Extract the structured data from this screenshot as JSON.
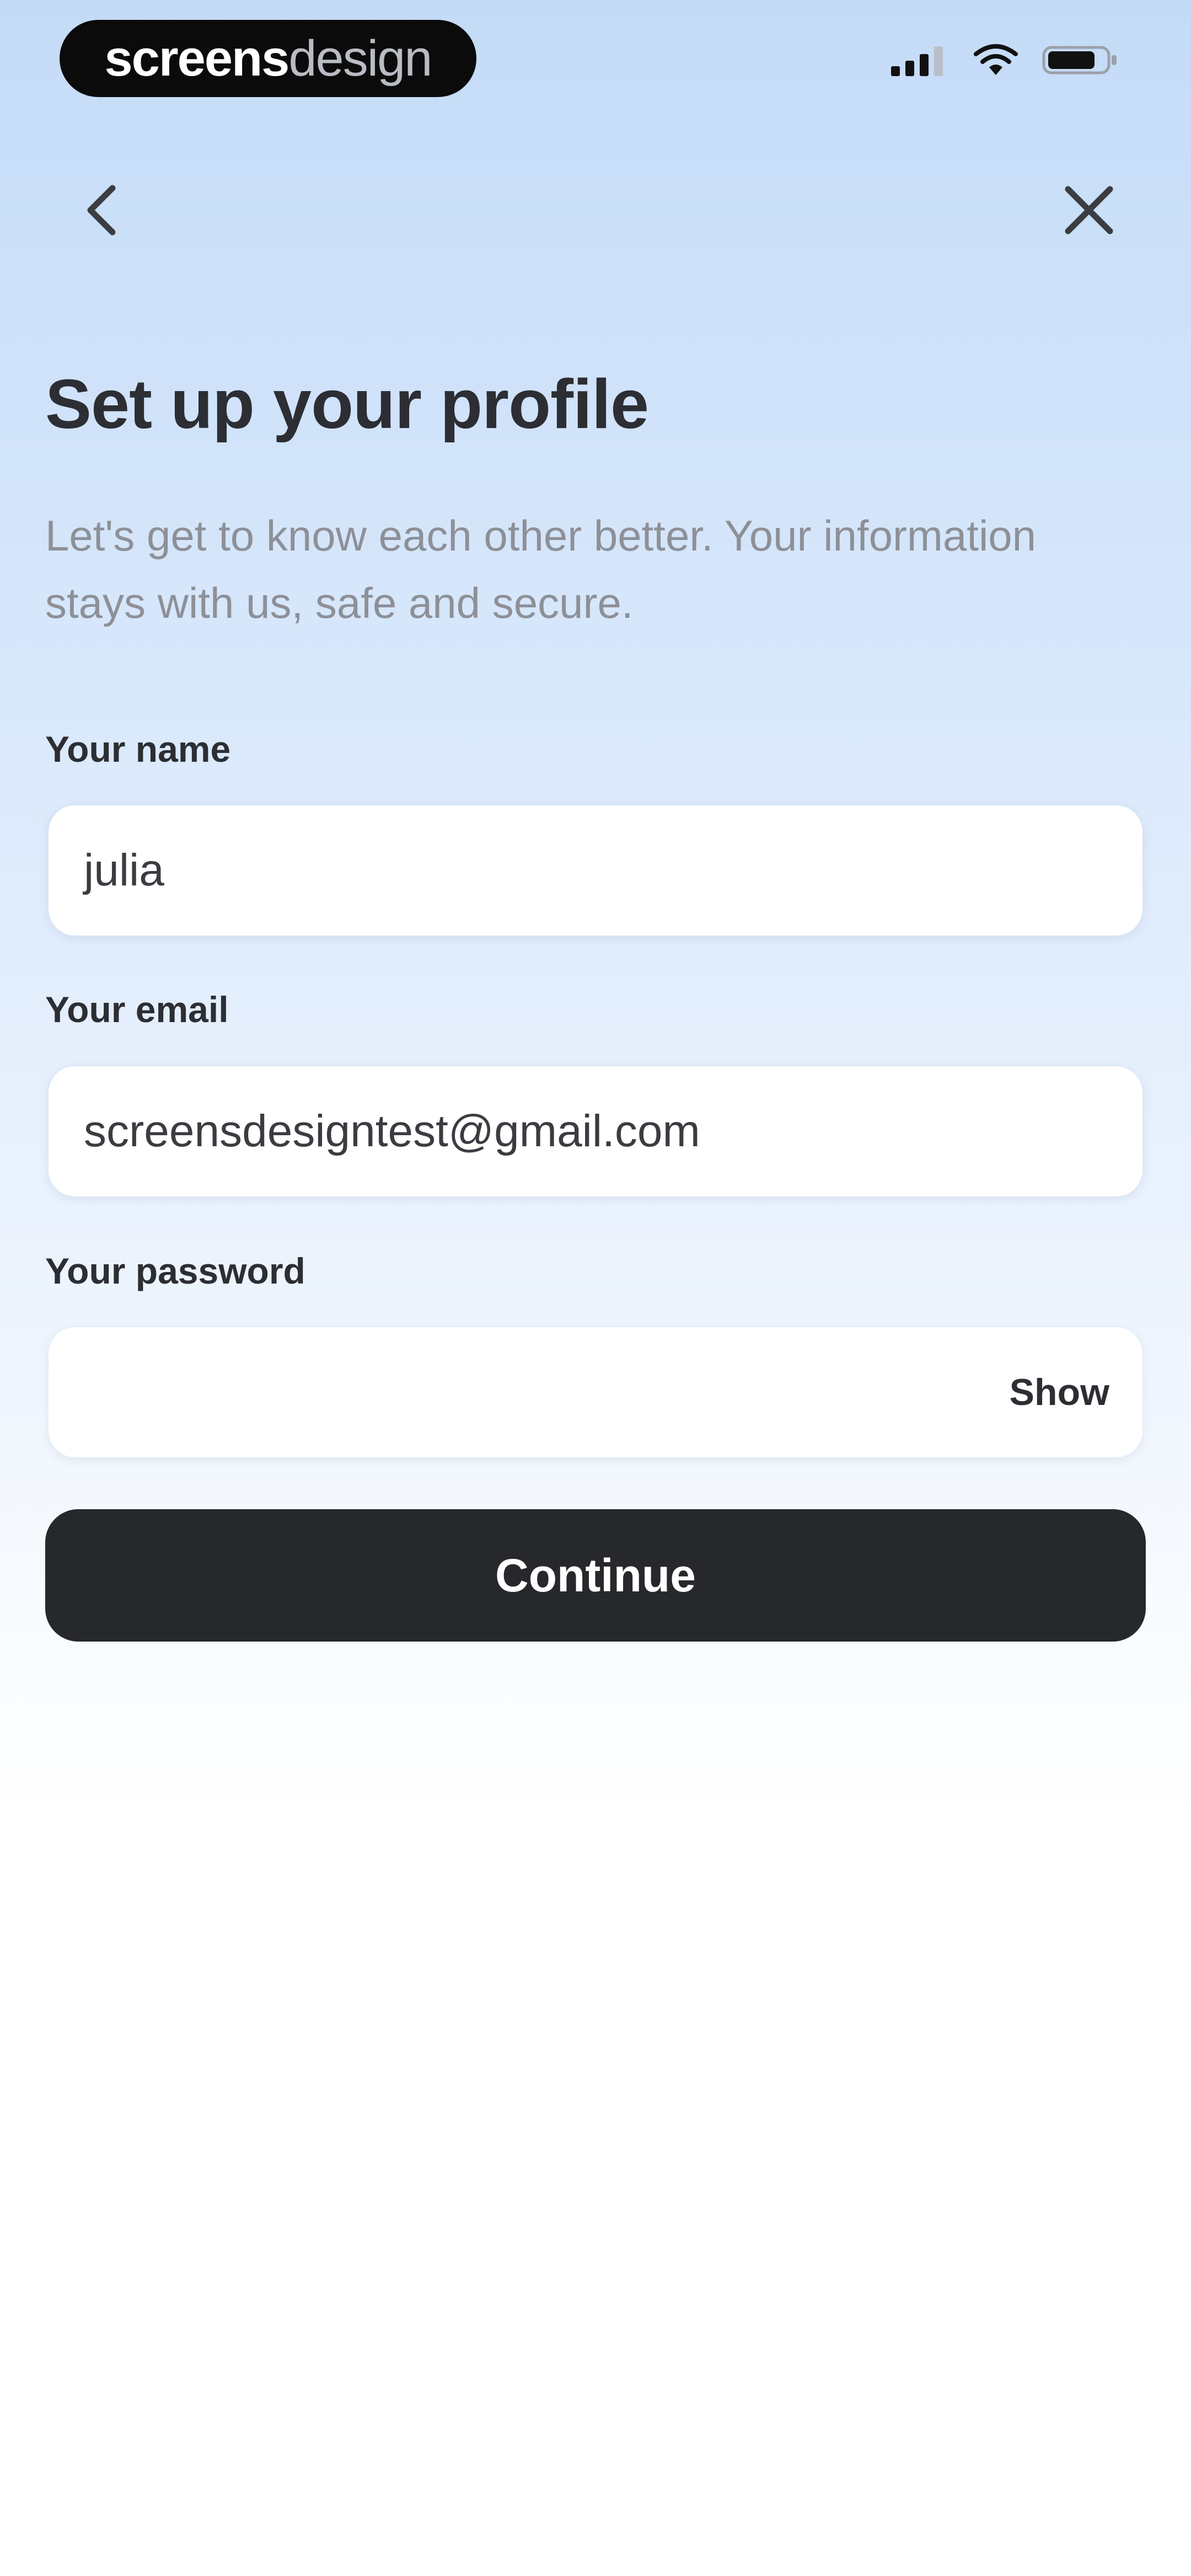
{
  "status_bar": {
    "brand_strong": "screens",
    "brand_light": "design",
    "icons": [
      "signal-icon",
      "wifi-icon",
      "battery-icon"
    ]
  },
  "nav": {
    "back_icon": "chevron-left-icon",
    "close_icon": "close-icon"
  },
  "header": {
    "title": "Set up your profile",
    "subtitle": "Let's get to know each other better. Your information stays with us, safe and secure."
  },
  "form": {
    "name": {
      "label": "Your name",
      "value": "julia"
    },
    "email": {
      "label": "Your email",
      "value": "screensdesigntest@gmail.com"
    },
    "password": {
      "label": "Your password",
      "value": "",
      "toggle_label": "Show"
    }
  },
  "actions": {
    "continue_label": "Continue"
  },
  "colors": {
    "gradient_top": "#c4dbf7",
    "gradient_bottom": "#ffffff",
    "primary_button": "#27282c",
    "text_dark": "#2c2e33",
    "text_muted": "#8d9097"
  }
}
